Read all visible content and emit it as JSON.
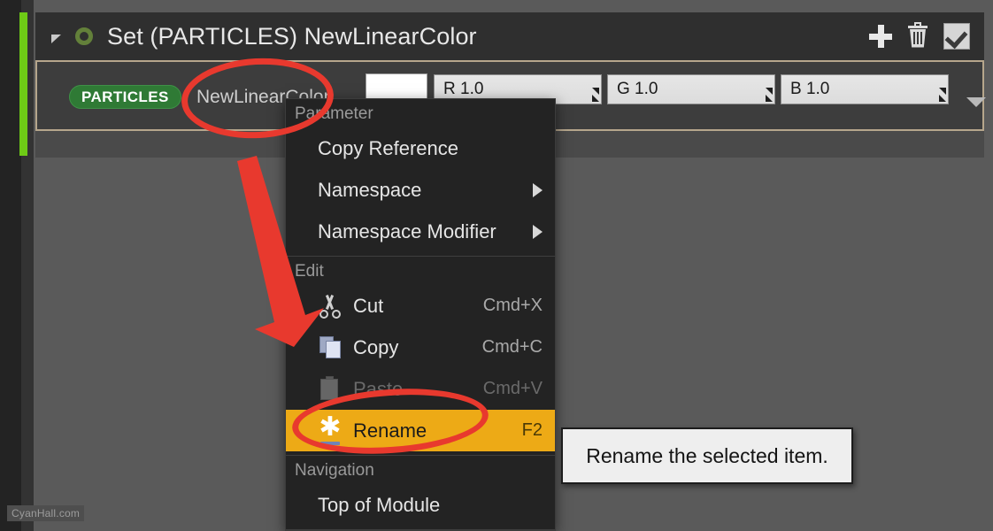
{
  "node": {
    "title": "Set (PARTICLES) NewLinearColor",
    "collapse_icon": "triangle-collapse-icon",
    "status_icon": "circle-icon",
    "header_actions": [
      {
        "name": "add-button",
        "icon": "plus-icon"
      },
      {
        "name": "delete-button",
        "icon": "trash-icon"
      },
      {
        "name": "enable-checkbox",
        "icon": "checkmark-icon",
        "checked": true
      }
    ],
    "parameter": {
      "namespace_badge": "PARTICLES",
      "namespace_badge_color": "#2f7a35",
      "name": "NewLinearColor",
      "color_swatch": "#ffffff",
      "fields": [
        {
          "label": "R",
          "value": "1.0",
          "display": "R  1.0"
        },
        {
          "label": "G",
          "value": "1.0",
          "display": "G  1.0"
        },
        {
          "label": "B",
          "value": "1.0",
          "display": "B  1.0"
        }
      ],
      "row_caret": "chevron-down-icon"
    }
  },
  "context_menu": {
    "sections": [
      {
        "title": "Parameter",
        "items": [
          {
            "label": "Copy Reference",
            "shortcut": "",
            "icon": "",
            "submenu": false,
            "disabled": false,
            "highlight": false
          },
          {
            "label": "Namespace",
            "shortcut": "",
            "icon": "",
            "submenu": true,
            "disabled": false,
            "highlight": false
          },
          {
            "label": "Namespace Modifier",
            "shortcut": "",
            "icon": "",
            "submenu": true,
            "disabled": false,
            "highlight": false
          }
        ]
      },
      {
        "title": "Edit",
        "items": [
          {
            "label": "Cut",
            "shortcut": "Cmd+X",
            "icon": "scissors-icon",
            "submenu": false,
            "disabled": false,
            "highlight": false
          },
          {
            "label": "Copy",
            "shortcut": "Cmd+C",
            "icon": "copy-icon",
            "submenu": false,
            "disabled": false,
            "highlight": false
          },
          {
            "label": "Paste",
            "shortcut": "Cmd+V",
            "icon": "paste-icon",
            "submenu": false,
            "disabled": true,
            "highlight": false
          },
          {
            "label": "Rename",
            "shortcut": "F2",
            "icon": "rename-icon",
            "submenu": false,
            "disabled": false,
            "highlight": true
          }
        ]
      },
      {
        "title": "Navigation",
        "items": [
          {
            "label": "Top of Module",
            "shortcut": "",
            "icon": "",
            "submenu": false,
            "disabled": false,
            "highlight": false
          }
        ]
      }
    ],
    "highlight_color": "#edaa16"
  },
  "tooltip": {
    "text": "Rename the selected item."
  },
  "annotations": {
    "color": "#e8392e",
    "ellipse_parameter_name": "highlight ellipse around NewLinearColor",
    "ellipse_rename": "highlight ellipse around Rename menu item",
    "arrow": "red arrow pointing to Rename"
  },
  "watermark": {
    "text": "CyanHall.com"
  }
}
